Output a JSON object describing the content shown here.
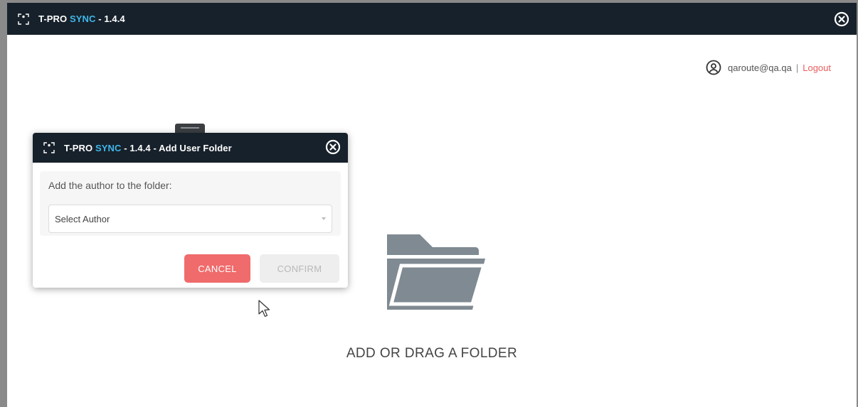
{
  "window": {
    "title_prefix": "T-PRO",
    "title_sync": "SYNC",
    "title_suffix": " - 1.4.4"
  },
  "user": {
    "email": "qaroute@qa.qa",
    "separator": "|",
    "logout_label": "Logout"
  },
  "main": {
    "drop_label": "ADD OR DRAG A FOLDER",
    "folder_icon": "folder-open-icon"
  },
  "dialog": {
    "title_prefix": "T-PRO",
    "title_sync": "SYNC",
    "title_suffix": " - 1.4.4 - Add User Folder",
    "prompt": "Add the author to the folder:",
    "select_value": "Select Author",
    "cancel_label": "CANCEL",
    "confirm_label": "CONFIRM"
  },
  "colors": {
    "titlebar": "#17212b",
    "accent_sync": "#3fb6e8",
    "cancel": "#f06b6b",
    "logout": "#e95d5d",
    "folder": "#7f8a92"
  }
}
